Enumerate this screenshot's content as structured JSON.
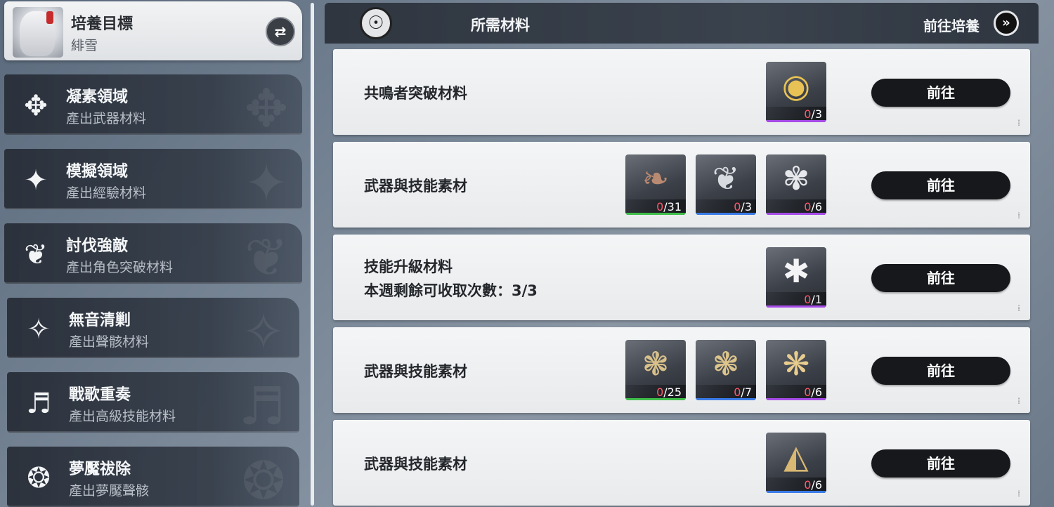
{
  "sidebar": {
    "target": {
      "title": "培養目標",
      "name": "緋雪"
    },
    "items": [
      {
        "title": "凝素領域",
        "sub": "產出武器材料",
        "icon": "✥"
      },
      {
        "title": "模擬領域",
        "sub": "產出經驗材料",
        "icon": "✦"
      },
      {
        "title": "討伐強敵",
        "sub": "產出角色突破材料",
        "icon": "❦"
      },
      {
        "title": "無音清剿",
        "sub": "產出聲骸材料",
        "icon": "✧"
      },
      {
        "title": "戰歌重奏",
        "sub": "產出高級技能材料",
        "icon": "♬"
      },
      {
        "title": "夢魘祓除",
        "sub": "產出夢魘聲骸",
        "icon": "❂"
      }
    ]
  },
  "header": {
    "title": "所需材料",
    "go_label": "前往培養"
  },
  "rows": [
    {
      "label": "共鳴者突破材料",
      "button": "前往",
      "materials": [
        {
          "have": "0",
          "need": "/3",
          "rarity": "purple",
          "icon": "gold-orb-icon"
        }
      ]
    },
    {
      "label": "武器與技能素材",
      "button": "前往",
      "materials": [
        {
          "have": "0",
          "need": "/31",
          "rarity": "green",
          "icon": "feather-icon"
        },
        {
          "have": "0",
          "need": "/3",
          "rarity": "blue",
          "icon": "blade-icon"
        },
        {
          "have": "0",
          "need": "/6",
          "rarity": "purple",
          "icon": "crystal-icon"
        }
      ]
    },
    {
      "label": "技能升級材料",
      "label2": "本週剩餘可收取次數：3/3",
      "button": "前往",
      "materials": [
        {
          "have": "0",
          "need": "/1",
          "rarity": "purple",
          "icon": "figure-icon"
        }
      ]
    },
    {
      "label": "武器與技能素材",
      "button": "前往",
      "materials": [
        {
          "have": "0",
          "need": "/25",
          "rarity": "green",
          "icon": "gold-flower-icon"
        },
        {
          "have": "0",
          "need": "/7",
          "rarity": "blue",
          "icon": "gold-flower-icon"
        },
        {
          "have": "0",
          "need": "/6",
          "rarity": "purple",
          "icon": "gold-flower-icon"
        }
      ]
    },
    {
      "label": "武器與技能素材",
      "button": "前往",
      "materials": [
        {
          "have": "0",
          "need": "/6",
          "rarity": "blue",
          "icon": "gold-triangle-icon"
        }
      ]
    }
  ]
}
